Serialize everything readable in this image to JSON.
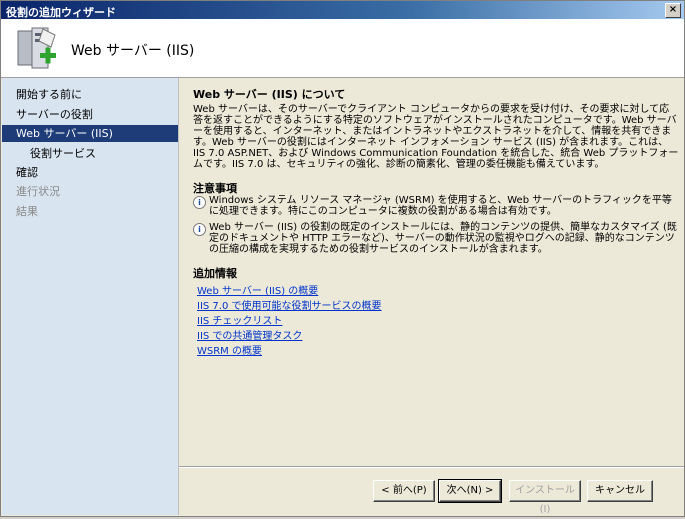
{
  "window": {
    "title": "役割の追加ウィザード",
    "close_label": "×"
  },
  "header": {
    "title": "Web サーバー (IIS)",
    "icon": "server-add-icon"
  },
  "sidebar": {
    "items": [
      {
        "label": "開始する前に",
        "state": "normal"
      },
      {
        "label": "サーバーの役割",
        "state": "normal"
      },
      {
        "label": "Web サーバー (IIS)",
        "state": "active"
      },
      {
        "label": "役割サービス",
        "state": "normal"
      },
      {
        "label": "確認",
        "state": "normal"
      },
      {
        "label": "進行状況",
        "state": "disabled"
      },
      {
        "label": "結果",
        "state": "disabled"
      }
    ]
  },
  "content": {
    "heading": "Web サーバー (IIS) について",
    "description": "Web サーバーは、そのサーバーでクライアント コンピュータからの要求を受け付け、その要求に対して応答を返すことができるようにする特定のソフトウェアがインストールされたコンピュータです。Web サーバーを使用すると、インターネット、またはイントラネットやエクストラネットを介して、情報を共有できます。Web サーバーの役割にはインターネット インフォメーション サービス (IIS) が含まれます。これは、IIS 7.0 ASP.NET、および Windows Communication Foundation を統合した、統合 Web プラットフォームです。IIS 7.0 は、セキュリティの強化、診断の簡素化、管理の委任機能も備えています。",
    "notes_title": "注意事項",
    "notes": [
      "Windows システム リソース マネージャ (WSRM) を使用すると、Web サーバーのトラフィックを平等に処理できます。特にこのコンピュータに複数の役割がある場合は有効です。",
      "Web サーバー (IIS) の役割の既定のインストールには、静的コンテンツの提供、簡単なカスタマイズ (既定のドキュメントや HTTP エラーなど)、サーバーの動作状況の監視やログへの記録、静的なコンテンツの圧縮の構成を実現するための役割サービスのインストールが含まれます。"
    ],
    "more_title": "追加情報",
    "links": [
      "Web サーバー (IIS) の概要",
      "IIS 7.0 で使用可能な役割サービスの概要",
      "IIS チェックリスト",
      "IIS での共通管理タスク",
      "WSRM の概要"
    ]
  },
  "buttons": {
    "back": "< 前へ(P)",
    "next": "次へ(N) >",
    "install": "インストール(I)",
    "cancel": "キャンセル"
  }
}
